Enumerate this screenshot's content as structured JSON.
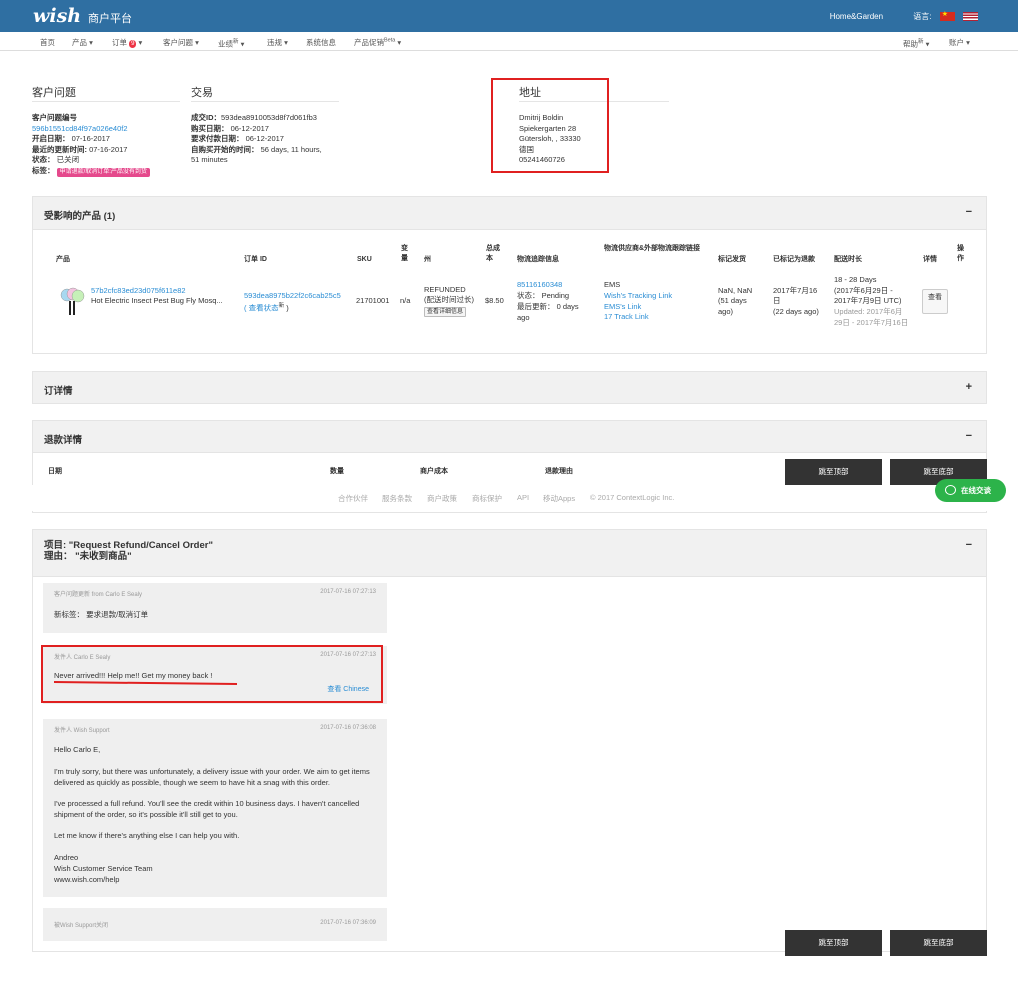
{
  "header": {
    "logo": "wish",
    "subtitle": "商户平台",
    "store": "Home&Garden",
    "language_label": "语言:"
  },
  "nav": {
    "items": [
      "首页",
      "产品",
      "订单",
      "客户问题",
      "业绩",
      "违规",
      "系统信息",
      "产品促销"
    ],
    "order_badge": "9",
    "perf_sup": "新",
    "promo_sup": "Beta",
    "help": "帮助",
    "help_sup": "新",
    "account": "账户"
  },
  "ticket": {
    "title": "客户问题",
    "id_label": "客户问题编号",
    "id": "596b1551cd84f97a026e40f2",
    "open_label": "开启日期：",
    "open": "07-16-2017",
    "updated_label": "最近的更新时间:",
    "updated": "07-16-2017",
    "state_label": "状态：",
    "state": "已关闭",
    "tag_label": "标签：",
    "tag": "申请退款/取消订单:产品没有到货"
  },
  "transaction": {
    "title": "交易",
    "txn_label": "成交ID：",
    "txn": "593dea8910053d8f7d061fb3",
    "buy_label": "购买日期：",
    "buy": "06-12-2017",
    "pay_label": "要求付款日期：",
    "pay": "06-12-2017",
    "since_label": "自购买开始的时间：",
    "since1": "56 days, 11 hours,",
    "since2": "51 minutes"
  },
  "address": {
    "title": "地址",
    "name": "Dmitrij Boldin",
    "street": "Spiekergarten 28",
    "city": "Gütersloh, , 33330",
    "country": "德国",
    "phone": "05241460726"
  },
  "products": {
    "title": "受影响的产品 (1)",
    "toggle": "−",
    "headers": {
      "product": "产品",
      "order_id": "订单 ID",
      "sku": "SKU",
      "var": "变量",
      "state": "州",
      "total": "总成本",
      "tracking": "物流追踪信息",
      "carrier": "物流供应商&外部物流跟踪链接",
      "marked": "标记发货",
      "refunded": "已标记为退款",
      "delivery": "配送时长",
      "detail": "详情",
      "action": "操作"
    },
    "row": {
      "pid": "57b2cfc83ed23d075f611e82",
      "pname": "Hot Electric Insect Pest Bug Fly Mosq...",
      "oid": "593dea8975b22f2c6cab25c5",
      "oid_sub": "( 查看状态",
      "oid_sup": "新",
      "sku": "21701001",
      "var": "n/a",
      "state1": "REFUNDED",
      "state2": "(配送时间过长)",
      "state_btn": "查看详细信息",
      "total": "$8.50",
      "track_no": "85116160348",
      "track_status": "状态： Pending",
      "track_updated": "最后更新： 0 days",
      "track_ago": "ago",
      "carrier": "EMS",
      "link1": "Wish's Tracking Link",
      "link2": "EMS's Link",
      "link3": "17 Track Link",
      "marked1": "NaN, NaN",
      "marked2": "(51 days",
      "marked3": "ago)",
      "ref1": "2017年7月16",
      "ref2": "日",
      "ref3": "(22 days ago)",
      "del1": "18 - 28 Days",
      "del2": "(2017年6月29日 -",
      "del3": "2017年7月9日 UTC)",
      "del4": "Updated: 2017年6月",
      "del5": "29日 - 2017年7月16日",
      "view": "查看"
    }
  },
  "order_detail": {
    "title": "订详情",
    "toggle": "+"
  },
  "refund": {
    "title": "退款详情",
    "toggle": "−",
    "cols": [
      "日期",
      "数量",
      "商户成本",
      "退款理由"
    ]
  },
  "buttons": {
    "top": "跳至顶部",
    "bottom": "跳至底部"
  },
  "footer": {
    "links": [
      "合作伙伴",
      "服务条款",
      "商户政策",
      "商标保护",
      "API",
      "移动Apps",
      "© 2017 ContextLogic Inc."
    ]
  },
  "chat": {
    "label": "在线交谈"
  },
  "issue": {
    "title1": "项目: \"Request Refund/Cancel Order\"",
    "title2": "理由： \"未收到商品\"",
    "toggle": "−"
  },
  "messages": [
    {
      "from": "客户问题更新 from Carlo E Sealy",
      "time": "2017-07-16 07:27:13",
      "lines": [
        "新标签： 要求退款/取消订单"
      ]
    },
    {
      "from": "发件人 Carlo E Sealy",
      "time": "2017-07-16 07:27:13",
      "lines": [
        "Never arrived!!! Help me!! Get my money back !"
      ],
      "translate": "查看 Chinese"
    },
    {
      "from": "发件人 Wish Support",
      "time": "2017-07-16 07:36:08",
      "lines": [
        "Hello Carlo E,",
        "I'm truly sorry, but there was unfortunately, a delivery issue with your order. We aim to get items delivered as quickly as possible, though we seem to have hit a snag with this order.",
        "I've processed a full refund. You'll see the credit within 10 business days. I haven't cancelled shipment of the order, so it's possible it'll still get to you.",
        "Let me know if there's anything else I can help you with.",
        "Andreo",
        "Wish Customer Service Team",
        "www.wish.com/help"
      ]
    },
    {
      "from": "被Wish Support关闭",
      "time": "2017-07-16 07:36:09",
      "lines": []
    }
  ]
}
